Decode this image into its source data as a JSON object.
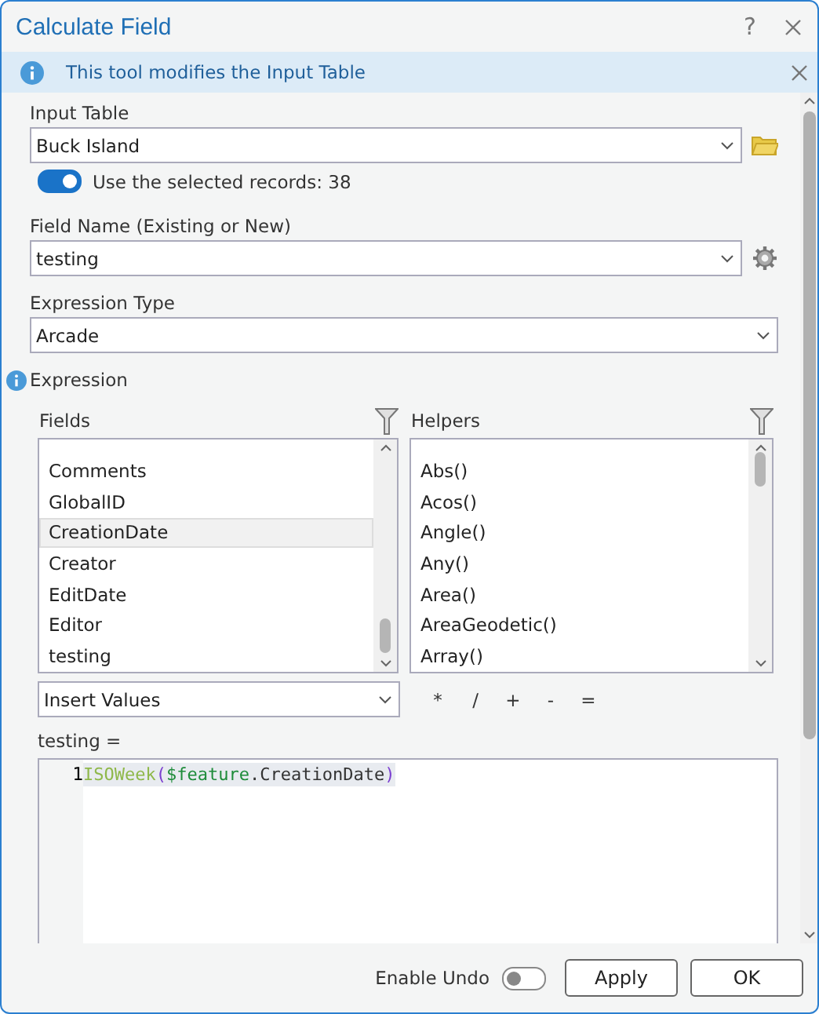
{
  "window": {
    "title": "Calculate Field",
    "help": "?"
  },
  "info_bar": {
    "message": "This tool modifies the Input Table"
  },
  "input_table": {
    "label": "Input Table",
    "value": "Buck Island"
  },
  "use_selected": {
    "label": "Use the selected records: 38",
    "on": true
  },
  "field_name": {
    "label": "Field Name (Existing or New)",
    "value": "testing"
  },
  "expression_type": {
    "label": "Expression Type",
    "value": "Arcade"
  },
  "expression": {
    "label": "Expression",
    "fields": {
      "title": "Fields",
      "items": [
        {
          "label": "Comments",
          "selected": false
        },
        {
          "label": "GlobalID",
          "selected": false
        },
        {
          "label": "CreationDate",
          "selected": true
        },
        {
          "label": "Creator",
          "selected": false
        },
        {
          "label": "EditDate",
          "selected": false
        },
        {
          "label": "Editor",
          "selected": false
        },
        {
          "label": "testing",
          "selected": false
        }
      ]
    },
    "helpers": {
      "title": "Helpers",
      "items": [
        {
          "label": "Abs()",
          "selected": false
        },
        {
          "label": "Acos()",
          "selected": false
        },
        {
          "label": "Angle()",
          "selected": false
        },
        {
          "label": "Any()",
          "selected": false
        },
        {
          "label": "Area()",
          "selected": false
        },
        {
          "label": "AreaGeodetic()",
          "selected": false
        },
        {
          "label": "Array()",
          "selected": false
        }
      ]
    },
    "insert_values": "Insert Values",
    "operators": [
      "*",
      "/",
      "+",
      "-",
      "="
    ],
    "target": "testing =",
    "line_number": "1",
    "code": [
      {
        "kind": "function",
        "text": "ISOWeek"
      },
      {
        "kind": "paren",
        "text": "("
      },
      {
        "kind": "variable",
        "text": "$feature"
      },
      {
        "kind": "plain",
        "text": ".CreationDate"
      },
      {
        "kind": "paren",
        "text": ")"
      }
    ]
  },
  "footer": {
    "enable_undo": {
      "label": "Enable Undo",
      "on": false
    },
    "buttons": [
      "Apply",
      "OK"
    ]
  }
}
